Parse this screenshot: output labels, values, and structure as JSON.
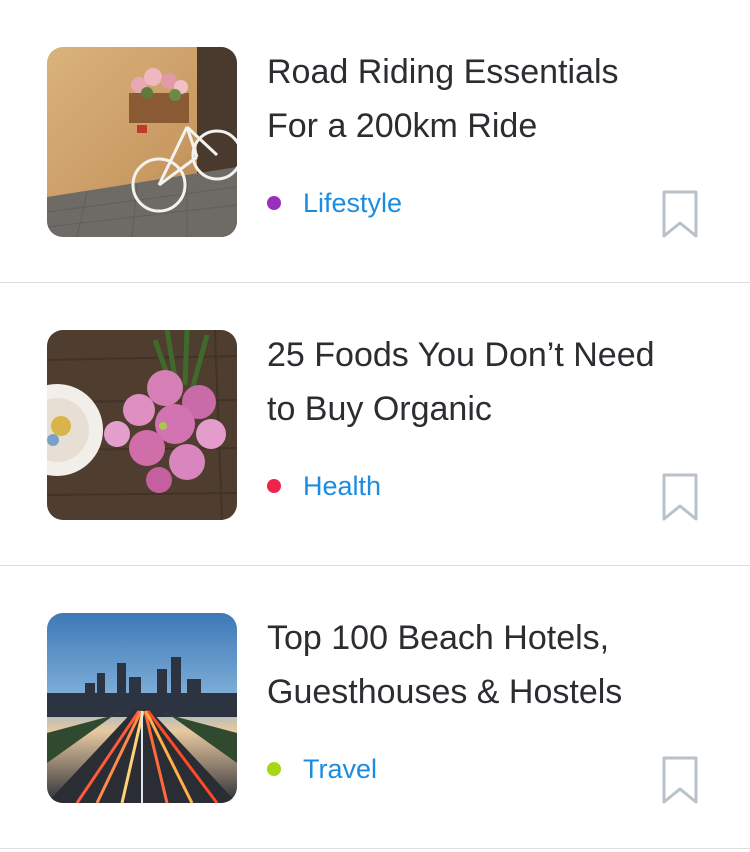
{
  "articles": [
    {
      "title_line1": "Road Riding Essentials",
      "title_line2": "For a 200km Ride",
      "category": "Lifestyle",
      "category_color": "#9b2fbd",
      "thumbnail": "bicycle-with-flower-basket-image",
      "bookmark_icon": "bookmark-icon"
    },
    {
      "title_line1": "25 Foods You Don’t Need",
      "title_line2": "to Buy Organic",
      "category": "Health",
      "category_color": "#f0234b",
      "thumbnail": "pink-dahlia-flowers-image",
      "bookmark_icon": "bookmark-icon"
    },
    {
      "title_line1": "Top 100 Beach Hotels,",
      "title_line2": "Guesthouses & Hostels",
      "category": "Travel",
      "category_color": "#a6d716",
      "thumbnail": "city-highway-light-trails-image",
      "bookmark_icon": "bookmark-icon"
    }
  ]
}
